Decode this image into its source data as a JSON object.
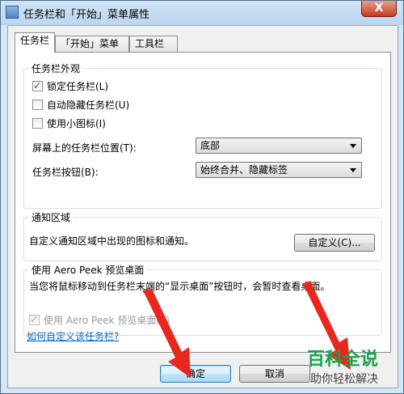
{
  "window": {
    "title": "任务栏和「开始」菜单属性",
    "close_label": "X"
  },
  "tabs": [
    {
      "label": "任务栏",
      "active": true
    },
    {
      "label": "「开始」菜单",
      "active": false
    },
    {
      "label": "工具栏",
      "active": false
    }
  ],
  "appearance": {
    "legend": "任务栏外观",
    "lock_label": "锁定任务栏(L)",
    "lock_checked": true,
    "autohide_label": "自动隐藏任务栏(U)",
    "autohide_checked": false,
    "small_icons_label": "使用小图标(I)",
    "small_icons_checked": false,
    "position_label": "屏幕上的任务栏位置(T):",
    "position_value": "底部",
    "buttons_label": "任务栏按钮(B):",
    "buttons_value": "始终合并、隐藏标签"
  },
  "notification": {
    "legend": "通知区域",
    "description": "自定义通知区域中出现的图标和通知。",
    "customize_label": "自定义(C)..."
  },
  "aeropeek": {
    "legend": "使用 Aero Peek 预览桌面",
    "description": "当您将鼠标移动到任务栏末端的“显示桌面”按钮时，会暂时查看桌面。",
    "checkbox_label": "使用 Aero Peek 预览桌面(P)",
    "checkbox_checked": true,
    "checkbox_disabled": true
  },
  "help_link": "如何自定义该任务栏?",
  "buttons": {
    "ok": "确定",
    "cancel": "取消"
  },
  "watermark": {
    "title": "百科全说",
    "subtitle": "助你轻松解决"
  },
  "colors": {
    "annotation_arrow": "#e8271e",
    "watermark_green": "#1aa34a"
  }
}
